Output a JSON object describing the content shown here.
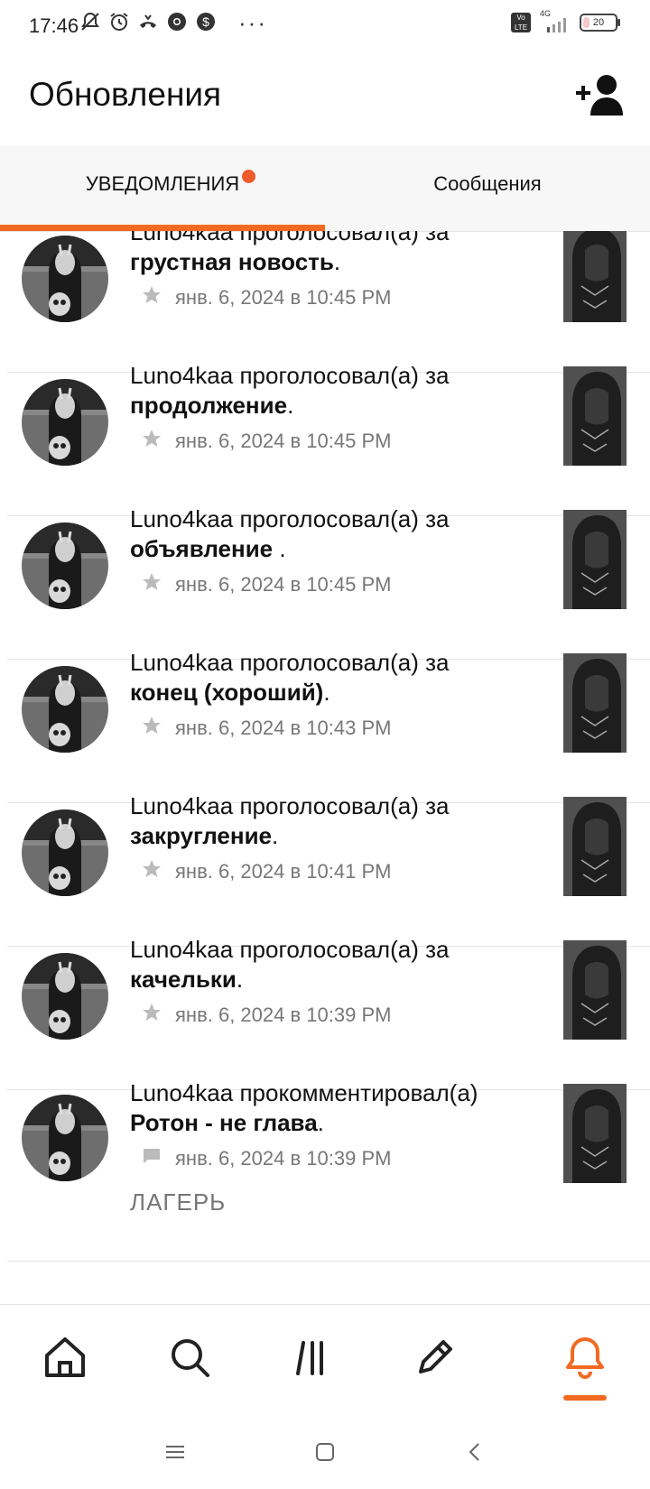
{
  "status_bar": {
    "time": "17:46",
    "left_icons": [
      "bell-off-icon",
      "alarm-icon",
      "call-forward-icon",
      "chrome-icon",
      "dollar-icon"
    ],
    "more": "···",
    "volte": "Vo LTE",
    "network": "4G",
    "battery": "20",
    "battery_level_percent": 20
  },
  "header": {
    "title": "Обновления",
    "add_user_icon": "add-user-icon"
  },
  "tabs": [
    {
      "label": "УВЕДОМЛЕНИЯ",
      "active": true,
      "has_dot": true
    },
    {
      "label": "Сообщения",
      "active": false,
      "has_dot": false
    }
  ],
  "notifications": [
    {
      "user": "Luno4kaa",
      "action": "проголосовал(а) за",
      "target": "грустная новость",
      "punct": ".",
      "icon": "star-icon",
      "time": "янв. 6, 2024 в 10:45 PM",
      "extra": ""
    },
    {
      "user": "Luno4kaa",
      "action": "проголосовал(а) за",
      "target": "продолжение",
      "punct": ".",
      "icon": "star-icon",
      "time": "янв. 6, 2024 в 10:45 PM",
      "extra": ""
    },
    {
      "user": "Luno4kaa",
      "action": "проголосовал(а) за",
      "target": "объявление ",
      "punct": ".",
      "icon": "star-icon",
      "time": "янв. 6, 2024 в 10:45 PM",
      "extra": ""
    },
    {
      "user": "Luno4kaa",
      "action": "проголосовал(а) за",
      "target": "конец (хороший)",
      "punct": ".",
      "icon": "star-icon",
      "time": "янв. 6, 2024 в 10:43 PM",
      "extra": ""
    },
    {
      "user": "Luno4kaa",
      "action": "проголосовал(а) за",
      "target": "закругление",
      "punct": ".",
      "icon": "star-icon",
      "time": "янв. 6, 2024 в 10:41 PM",
      "extra": ""
    },
    {
      "user": "Luno4kaa",
      "action": "проголосовал(а) за",
      "target": "качельки",
      "punct": ".",
      "icon": "star-icon",
      "time": "янв. 6, 2024 в 10:39 PM",
      "extra": ""
    },
    {
      "user": "Luno4kaa",
      "action": "прокомментировал(а)",
      "target": "Ротон - не глава",
      "punct": ".",
      "icon": "comment-icon",
      "time": "янв. 6, 2024 в 10:39 PM",
      "extra": "ЛАГЕРЬ"
    }
  ],
  "bottom_nav": [
    {
      "icon": "home-icon",
      "active": false
    },
    {
      "icon": "search-icon",
      "active": false
    },
    {
      "icon": "library-icon",
      "active": false
    },
    {
      "icon": "write-icon",
      "active": false
    },
    {
      "icon": "bell-icon",
      "active": true
    }
  ],
  "colors": {
    "accent": "#f26a21",
    "dot": "#ef5a2b",
    "muted_text": "#777777",
    "tab_bg": "#f7f7f7"
  }
}
